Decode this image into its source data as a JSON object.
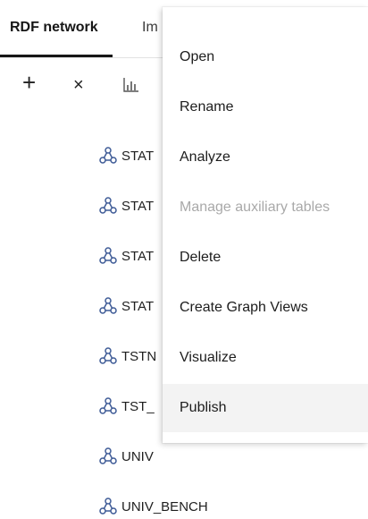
{
  "tabs": [
    {
      "label": "RDF network",
      "active": true
    },
    {
      "label": "Im",
      "active": false
    }
  ],
  "toolbar": {
    "add_icon": "+",
    "remove_icon": "×",
    "analyze_icon": "chart-icon"
  },
  "networks": [
    {
      "name": "STAT"
    },
    {
      "name": "STAT"
    },
    {
      "name": "STAT"
    },
    {
      "name": "STAT"
    },
    {
      "name": "TSTN"
    },
    {
      "name": "TST_"
    },
    {
      "name": "UNIV"
    },
    {
      "name": "UNIV_BENCH"
    }
  ],
  "context_menu": {
    "items": [
      {
        "label": "Open",
        "enabled": true
      },
      {
        "label": "Rename",
        "enabled": true
      },
      {
        "label": "Analyze",
        "enabled": true
      },
      {
        "label": "Manage auxiliary tables",
        "enabled": false
      },
      {
        "label": "Delete",
        "enabled": true
      },
      {
        "label": "Create Graph Views",
        "enabled": true
      },
      {
        "label": "Visualize",
        "enabled": true
      },
      {
        "label": "Publish",
        "enabled": true,
        "hovered": true
      }
    ]
  },
  "colors": {
    "graph_icon": "#3d5a96",
    "active_tab": "#161616",
    "disabled_text": "#a9a9a9",
    "hover_bg": "#f3f3f3"
  }
}
